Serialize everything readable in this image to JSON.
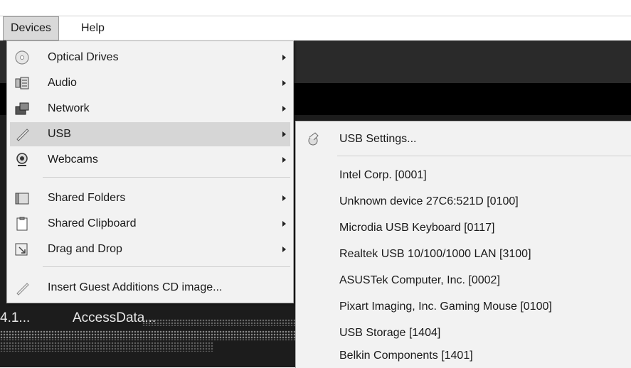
{
  "menubar": {
    "items": [
      {
        "label": "Devices"
      },
      {
        "label": "Help"
      }
    ]
  },
  "background": {
    "version_fragment": "4.1...",
    "app_text": "AccessData..."
  },
  "devices_menu": {
    "items": [
      {
        "label": "Optical Drives",
        "icon": "optical-drive-icon",
        "has_submenu": true
      },
      {
        "label": "Audio",
        "icon": "audio-icon",
        "has_submenu": true
      },
      {
        "label": "Network",
        "icon": "network-icon",
        "has_submenu": true
      },
      {
        "label": "USB",
        "icon": "usb-icon",
        "has_submenu": true,
        "highlighted": true
      },
      {
        "label": "Webcams",
        "icon": "webcam-icon",
        "has_submenu": true
      },
      {
        "label": "Shared Folders",
        "icon": "shared-folder-icon",
        "has_submenu": true
      },
      {
        "label": "Shared Clipboard",
        "icon": "clipboard-icon",
        "has_submenu": true
      },
      {
        "label": "Drag and Drop",
        "icon": "drag-drop-icon",
        "has_submenu": true
      },
      {
        "label": "Insert Guest Additions CD image...",
        "icon": "guest-additions-icon",
        "has_submenu": false
      }
    ]
  },
  "usb_submenu": {
    "settings_label": "USB Settings...",
    "settings_icon": "usb-settings-icon",
    "devices": [
      "Intel Corp. [0001]",
      "Unknown device 27C6:521D [0100]",
      "Microdia USB Keyboard [0117]",
      "Realtek USB 10/100/1000 LAN [3100]",
      "ASUSTek Computer, Inc. [0002]",
      "Pixart Imaging, Inc. Gaming Mouse [0100]",
      "USB Storage [1404]",
      "Belkin Components [1401]"
    ]
  },
  "colors": {
    "menu_bg": "#f2f2f2",
    "highlight": "#d6d6d6",
    "vm_bg": "#1c1c1c"
  }
}
